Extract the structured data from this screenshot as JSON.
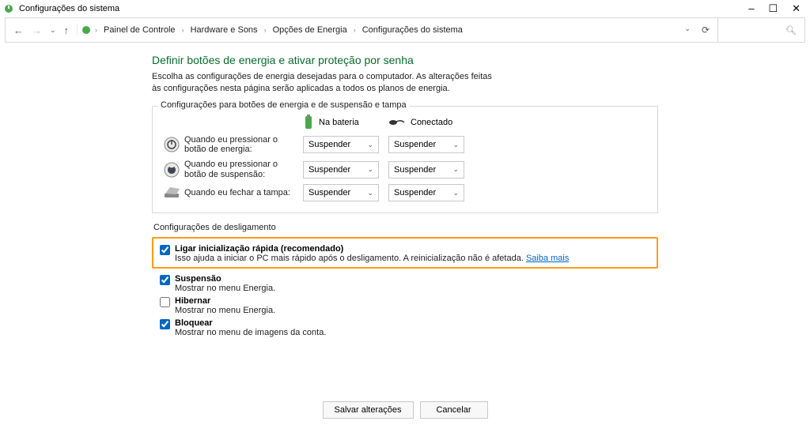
{
  "window": {
    "title": "Configurações do sistema",
    "minimize": "–",
    "maximize": "☐",
    "close": "✕"
  },
  "breadcrumb": {
    "items": [
      "Painel de Controle",
      "Hardware e Sons",
      "Opções de Energia",
      "Configurações do sistema"
    ]
  },
  "page": {
    "heading": "Definir botões de energia e ativar proteção por senha",
    "intro": "Escolha as configurações de energia desejadas para o computador. As alterações feitas às configurações nesta página serão aplicadas a todos os planos de energia.",
    "section1_legend": "Configurações para botões de energia e de suspensão e tampa",
    "col_battery": "Na bateria",
    "col_plugged": "Conectado"
  },
  "rows": {
    "power": {
      "label": "Quando eu pressionar o botão de energia:",
      "battery": "Suspender",
      "plugged": "Suspender"
    },
    "sleep": {
      "label": "Quando eu pressionar o botão de suspensão:",
      "battery": "Suspender",
      "plugged": "Suspender"
    },
    "lid": {
      "label": "Quando eu fechar a tampa:",
      "battery": "Suspender",
      "plugged": "Suspender"
    }
  },
  "shutdown": {
    "heading": "Configurações de desligamento",
    "fast": {
      "title": "Ligar inicialização rápida (recomendado)",
      "desc": "Isso ajuda a iniciar o PC mais rápido após o desligamento. A reinicialização não é afetada. ",
      "link": "Saiba mais"
    },
    "suspend": {
      "title": "Suspensão",
      "desc": "Mostrar no menu Energia."
    },
    "hibernate": {
      "title": "Hibernar",
      "desc": "Mostrar no menu Energia."
    },
    "lock": {
      "title": "Bloquear",
      "desc": "Mostrar no menu de imagens da conta."
    }
  },
  "buttons": {
    "save": "Salvar alterações",
    "cancel": "Cancelar"
  }
}
